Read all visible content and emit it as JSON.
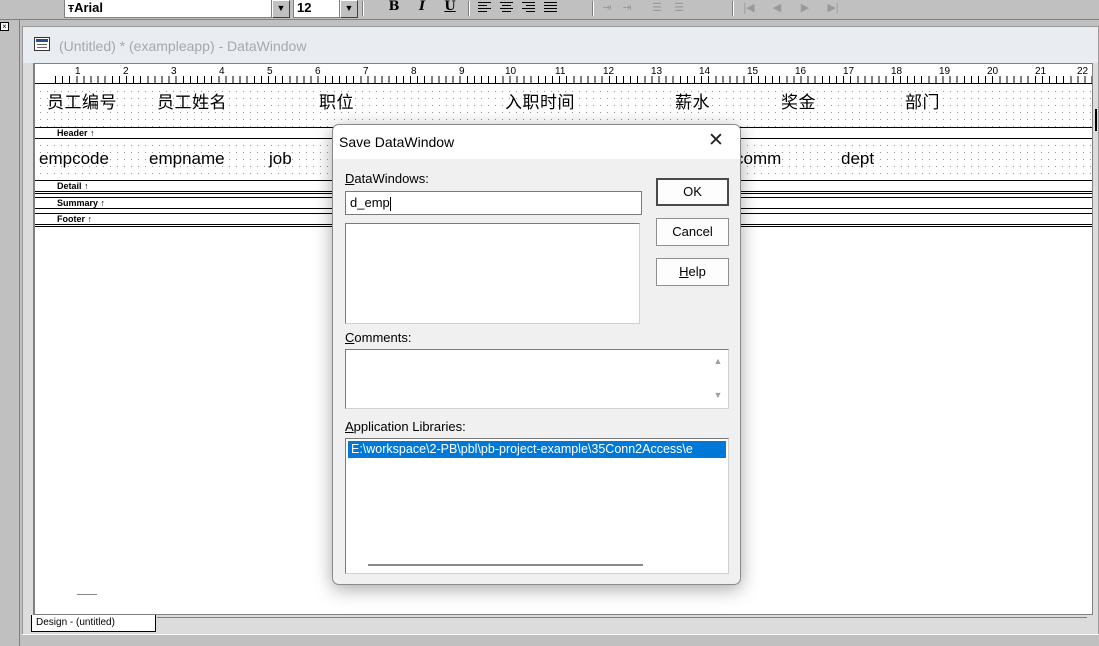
{
  "toolbar": {
    "font_name": "Arial",
    "font_size": "12",
    "bold_label": "B",
    "italic_label": "I",
    "underline_label": "U"
  },
  "window": {
    "title": "(Untitled) * (exampleapp) - DataWindow"
  },
  "ruler": {
    "numbers": [
      "1",
      "2",
      "3",
      "4",
      "5",
      "6",
      "7",
      "8",
      "9",
      "10",
      "11",
      "12",
      "13",
      "14",
      "15",
      "16",
      "17",
      "18",
      "19",
      "20",
      "21",
      "22"
    ]
  },
  "header_band": {
    "columns": [
      "员工编号",
      "员工姓名",
      "职位",
      "入职时间",
      "薪水",
      "奖金",
      "部门"
    ]
  },
  "detail_band": {
    "columns": [
      "empcode",
      "empname",
      "job",
      "comm",
      "dept"
    ]
  },
  "bands": {
    "header": "Header",
    "detail": "Detail",
    "summary": "Summary",
    "footer": "Footer"
  },
  "design_tab": "Design - (untitled)",
  "dialog": {
    "title": "Save DataWindow",
    "datawindows_label_key": "D",
    "datawindows_label_rest": "ataWindows:",
    "datawindow_name": "d_emp",
    "comments_label_key": "C",
    "comments_label_rest": "omments:",
    "app_libraries_label_key": "A",
    "app_libraries_label_rest": "pplication Libraries:",
    "library_path": "E:\\workspace\\2-PB\\pbl\\pb-project-example\\35Conn2Access\\e",
    "ok_label": "OK",
    "cancel_label": "Cancel",
    "help_label_key": "H",
    "help_label_rest": "elp"
  }
}
